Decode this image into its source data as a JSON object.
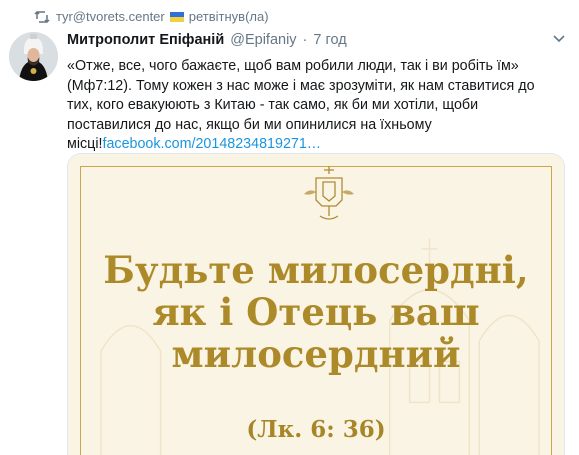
{
  "retweet": {
    "icon": "retweet-icon",
    "user": "тyr@tvorets.center",
    "flag": "ukraine-flag",
    "action": "ретвітнув(ла)"
  },
  "tweet": {
    "author_name": "Митрополит Епіфаній",
    "author_handle": "@Epifaniy",
    "separator": "·",
    "time": "7 год",
    "text_lines": [
      "«Отже, все, чого бажаєте, щоб вам робили люди, так і ви робіть їм»",
      "(Мф7:12). Тому кожен з нас може і має зрозуміти, як нам ставитися до",
      "тих, кого евакуюють з Китаю - так само, як би ми хотіли, щоби",
      "поставилися до нас, якщо би ми опинилися на їхньому"
    ],
    "last_line_text": "місці!",
    "link_text": "facebook.com/20148234819271…"
  },
  "media": {
    "title_lines": [
      "Будьте милосердні,",
      "як і Отець ваш",
      "милосердний"
    ],
    "reference": "(Лк. 6: 36)"
  },
  "colors": {
    "link": "#1b95e0",
    "muted": "#657786",
    "gold": "#ad8a29",
    "cream": "#faf4e4"
  }
}
